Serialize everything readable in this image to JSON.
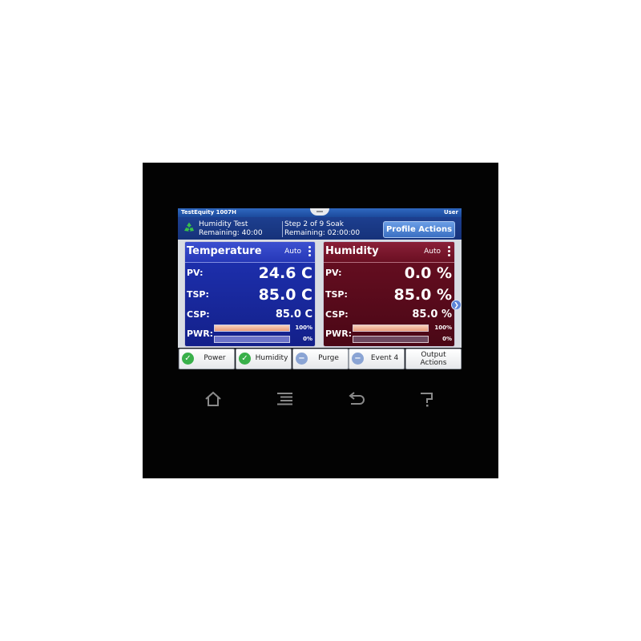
{
  "titlebar": {
    "app": "TestEquity 1007H",
    "user": "User"
  },
  "profile": {
    "name": "Humidity Test",
    "remaining": "Remaining: 40:00",
    "step": "Step 2 of 9 Soak",
    "step_remaining": "Remaining: 02:00:00",
    "button": "Profile Actions"
  },
  "temperature": {
    "title": "Temperature",
    "mode": "Auto",
    "pv_label": "PV:",
    "pv": "24.6 C",
    "tsp_label": "TSP:",
    "tsp": "85.0 C",
    "csp_label": "CSP:",
    "csp": "85.0 C",
    "pwr_label": "PWR:",
    "pwr_heat_pct": "100%",
    "pwr_heat_level": 100,
    "pwr_cool_pct": "0%",
    "pwr_cool_level": 0
  },
  "humidity": {
    "title": "Humidity",
    "mode": "Auto",
    "pv_label": "PV:",
    "pv": "0.0 %",
    "tsp_label": "TSP:",
    "tsp": "85.0 %",
    "csp_label": "CSP:",
    "csp": "85.0 %",
    "pwr_label": "PWR:",
    "pwr_heat_pct": "100%",
    "pwr_heat_level": 100,
    "pwr_cool_pct": "0%",
    "pwr_cool_level": 0
  },
  "outputs": [
    {
      "label": "Power",
      "state": "on"
    },
    {
      "label": "Humidity",
      "state": "on"
    },
    {
      "label": "Purge",
      "state": "off"
    },
    {
      "label": "Event 4",
      "state": "off"
    }
  ],
  "output_actions": {
    "line1": "Output",
    "line2": "Actions"
  },
  "nav_icons": [
    "home-icon",
    "menu-icon",
    "back-icon",
    "help-icon"
  ],
  "colors": {
    "temp_panel": "#1f32b3",
    "humidity_panel": "#6a0f22",
    "on": "#39b04a",
    "off": "#8aa4d4"
  }
}
